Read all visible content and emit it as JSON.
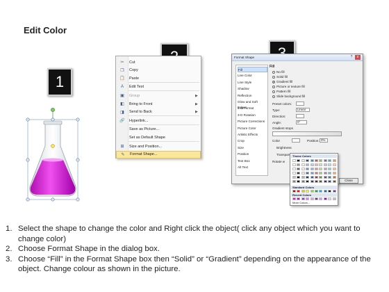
{
  "title": "Edit Color",
  "badges": [
    "1",
    "2",
    "3"
  ],
  "context_menu": {
    "items": [
      {
        "icon": "scissors-icon",
        "glyph": "✂",
        "label": "Cut",
        "arrow": false,
        "disabled": false
      },
      {
        "icon": "copy-icon",
        "glyph": "❐",
        "label": "Copy",
        "arrow": false,
        "disabled": false
      },
      {
        "icon": "paste-icon",
        "glyph": "📋",
        "label": "Paste",
        "arrow": false,
        "disabled": false
      },
      {
        "icon": "edit-text-icon",
        "glyph": "A",
        "label": "Edit Text",
        "arrow": false,
        "disabled": false
      },
      {
        "icon": "group-icon",
        "glyph": "▣",
        "label": "Group",
        "arrow": true,
        "disabled": true
      },
      {
        "icon": "bring-front-icon",
        "glyph": "◧",
        "label": "Bring to Front",
        "arrow": true,
        "disabled": false
      },
      {
        "icon": "send-back-icon",
        "glyph": "◨",
        "label": "Send to Back",
        "arrow": true,
        "disabled": false
      },
      {
        "icon": "hyperlink-icon",
        "glyph": "🔗",
        "label": "Hyperlink...",
        "arrow": false,
        "disabled": false
      },
      {
        "icon": "save-picture-icon",
        "glyph": "",
        "label": "Save as Picture...",
        "arrow": false,
        "disabled": false
      },
      {
        "icon": "default-shape-icon",
        "glyph": "",
        "label": "Set as Default Shape",
        "arrow": false,
        "disabled": false
      },
      {
        "icon": "size-position-icon",
        "glyph": "⊞",
        "label": "Size and Position...",
        "arrow": false,
        "disabled": false
      },
      {
        "icon": "format-shape-icon",
        "glyph": "✎",
        "label": "Format Shape...",
        "arrow": false,
        "disabled": false
      }
    ]
  },
  "dialog": {
    "title": "Format Shape",
    "help": "?",
    "close": "x",
    "nav": [
      "Fill",
      "Line Color",
      "Line Style",
      "Shadow",
      "Reflection",
      "Glow and Soft Edges",
      "3-D Format",
      "3-D Rotation",
      "Picture Corrections",
      "Picture Color",
      "Artistic Effects",
      "Crop",
      "Size",
      "Position",
      "Text Box",
      "Alt Text"
    ],
    "fill_heading": "Fill",
    "options": [
      "No fill",
      "Solid fill",
      "Gradient fill",
      "Picture or texture fill",
      "Pattern fill",
      "Slide background fill"
    ],
    "preset_label": "Preset colors:",
    "type_label": "Type:",
    "type_value": "Linear",
    "direction_label": "Direction:",
    "angle_label": "Angle:",
    "angle_value": "0°",
    "stops_label": "Gradient stops",
    "color_label": "Color",
    "position_label": "Position:",
    "position_value": "0%",
    "brightness_label": "Brightness",
    "transparency_label": "Transparency",
    "rotate_label": "Rotate w",
    "close_button": "Close"
  },
  "palette": {
    "theme_label": "Theme Colors",
    "standard_label": "Standard Colors",
    "recent_label": "Recent Colors",
    "more_label": "More Colors...",
    "theme_row": [
      "#ffffff",
      "#000000",
      "#eeece1",
      "#1f497d",
      "#4f81bd",
      "#c0504d",
      "#9bbb59",
      "#8064a2",
      "#4bacc6",
      "#f79646"
    ],
    "standard_row": [
      "#c00000",
      "#ff0000",
      "#ffc000",
      "#ffff00",
      "#92d050",
      "#00b050",
      "#00b0f0",
      "#0070c0",
      "#002060",
      "#7030a0"
    ],
    "recent_row": [
      "#ff00ff",
      "#cc00cc",
      "#9933cc",
      "#ff66ff",
      "#e0a0e0",
      "#663399",
      "#cc99ff",
      "#9900cc",
      "#ffccff",
      "#c0c0c0"
    ]
  },
  "steps": [
    {
      "num": "1.",
      "text": "Select the shape to change the color and Right click the object( click any object which you want to change color)"
    },
    {
      "num": "2.",
      "text": "Choose Format Shape in the dialog box."
    },
    {
      "num": "3.",
      "text": "Choose “Fill” in the Format Shape box then “Solid” or “Gradient” depending on the appearance of the object. Change colour as shown in the picture."
    }
  ],
  "colors": {
    "flask_liquid": "#d81fd8",
    "highlight": "#fbe79a",
    "dialog_title": "#d3e0f2"
  }
}
